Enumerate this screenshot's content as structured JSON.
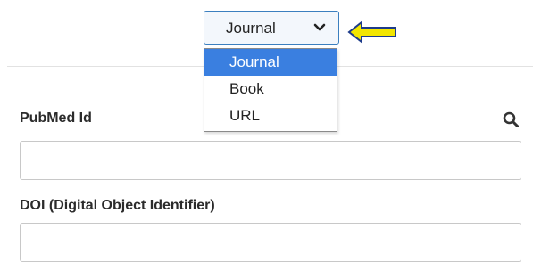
{
  "type_select": {
    "selected": "Journal",
    "options": [
      "Journal",
      "Book",
      "URL"
    ]
  },
  "fields": {
    "pubmed_label": "PubMed Id",
    "pubmed_value": "",
    "doi_label": "DOI (Digital Object Identifier)",
    "doi_value": ""
  },
  "icons": {
    "dropdown": "chevron-down-icon",
    "pointer": "arrow-left-icon",
    "search": "search-icon"
  },
  "colors": {
    "selected_option_bg": "#3a7fe0",
    "select_border": "#3b7fbf",
    "pointer_arrow_fill": "#f2e600",
    "pointer_arrow_stroke": "#1d3b8a"
  }
}
